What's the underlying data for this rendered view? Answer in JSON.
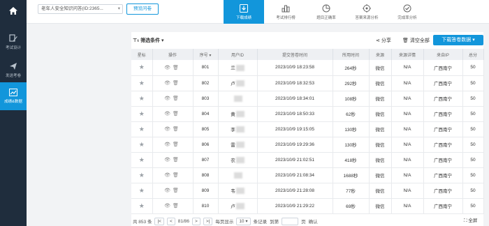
{
  "sidebar": {
    "home_icon": "home-icon",
    "items": [
      {
        "label": "考试设计",
        "icon": "pencil-icon",
        "active": false
      },
      {
        "label": "发送考卷",
        "icon": "send-icon",
        "active": false
      },
      {
        "label": "成绩&数据",
        "icon": "chart-icon",
        "active": true
      }
    ]
  },
  "header": {
    "survey_select": "老年人安全知识问答(ID:2365...",
    "preview_button": "预览问卷",
    "tabs": [
      {
        "label": "下载成绩",
        "icon": "download-icon",
        "active": true
      },
      {
        "label": "考试排行榜",
        "icon": "ranking-icon",
        "active": false
      },
      {
        "label": "题目正确率",
        "icon": "pie-icon",
        "active": false
      },
      {
        "label": "答案来源分析",
        "icon": "target-icon",
        "active": false
      },
      {
        "label": "完成率分析",
        "icon": "check-circle-icon",
        "active": false
      }
    ]
  },
  "toolbar": {
    "filter_label": "筛选条件",
    "share_label": "分享",
    "clear_label": "清空全部",
    "download_label": "下载答卷数据"
  },
  "table": {
    "headers": [
      "星标",
      "操作",
      "序号",
      "用户ID",
      "提交答卷时间",
      "所用时间",
      "来源",
      "来源详情",
      "来自IP",
      "总分"
    ],
    "rows": [
      {
        "seq": "801",
        "user": "兰",
        "time": "2023/10/9 18:23:58",
        "used": "264秒",
        "source": "微信",
        "detail": "N/A",
        "ip": "广西南宁",
        "score": "50"
      },
      {
        "seq": "802",
        "user": "卢",
        "time": "2023/10/9 18:32:53",
        "used": "292秒",
        "source": "微信",
        "detail": "N/A",
        "ip": "广西南宁",
        "score": "50"
      },
      {
        "seq": "803",
        "user": "",
        "time": "2023/10/9 18:34:01",
        "used": "108秒",
        "source": "微信",
        "detail": "N/A",
        "ip": "广西南宁",
        "score": "50"
      },
      {
        "seq": "804",
        "user": "黄",
        "time": "2023/10/9 18:50:33",
        "used": "62秒",
        "source": "微信",
        "detail": "N/A",
        "ip": "广西南宁",
        "score": "50"
      },
      {
        "seq": "805",
        "user": "李",
        "time": "2023/10/9 19:15:05",
        "used": "130秒",
        "source": "微信",
        "detail": "N/A",
        "ip": "广西南宁",
        "score": "50"
      },
      {
        "seq": "806",
        "user": "雷",
        "time": "2023/10/9 19:29:36",
        "used": "130秒",
        "source": "微信",
        "detail": "N/A",
        "ip": "广西南宁",
        "score": "50"
      },
      {
        "seq": "807",
        "user": "农",
        "time": "2023/10/9 21:02:51",
        "used": "418秒",
        "source": "微信",
        "detail": "N/A",
        "ip": "广西南宁",
        "score": "50"
      },
      {
        "seq": "808",
        "user": "",
        "time": "2023/10/9 21:08:34",
        "used": "1688秒",
        "source": "微信",
        "detail": "N/A",
        "ip": "广西南宁",
        "score": "50"
      },
      {
        "seq": "809",
        "user": "韦",
        "time": "2023/10/9 21:28:08",
        "used": "77秒",
        "source": "微信",
        "detail": "N/A",
        "ip": "广西南宁",
        "score": "50"
      },
      {
        "seq": "810",
        "user": "卢",
        "time": "2023/10/9 21:29:22",
        "used": "69秒",
        "source": "微信",
        "detail": "N/A",
        "ip": "广西南宁",
        "score": "50"
      }
    ]
  },
  "pager": {
    "total": "共 853 条",
    "page": "81/86",
    "per_page_label": "每页显示",
    "per_page": "10",
    "records_label": "条记录",
    "goto_label": "到第",
    "page_unit": "页",
    "confirm": "确认"
  },
  "fullscreen_label": "全屏"
}
